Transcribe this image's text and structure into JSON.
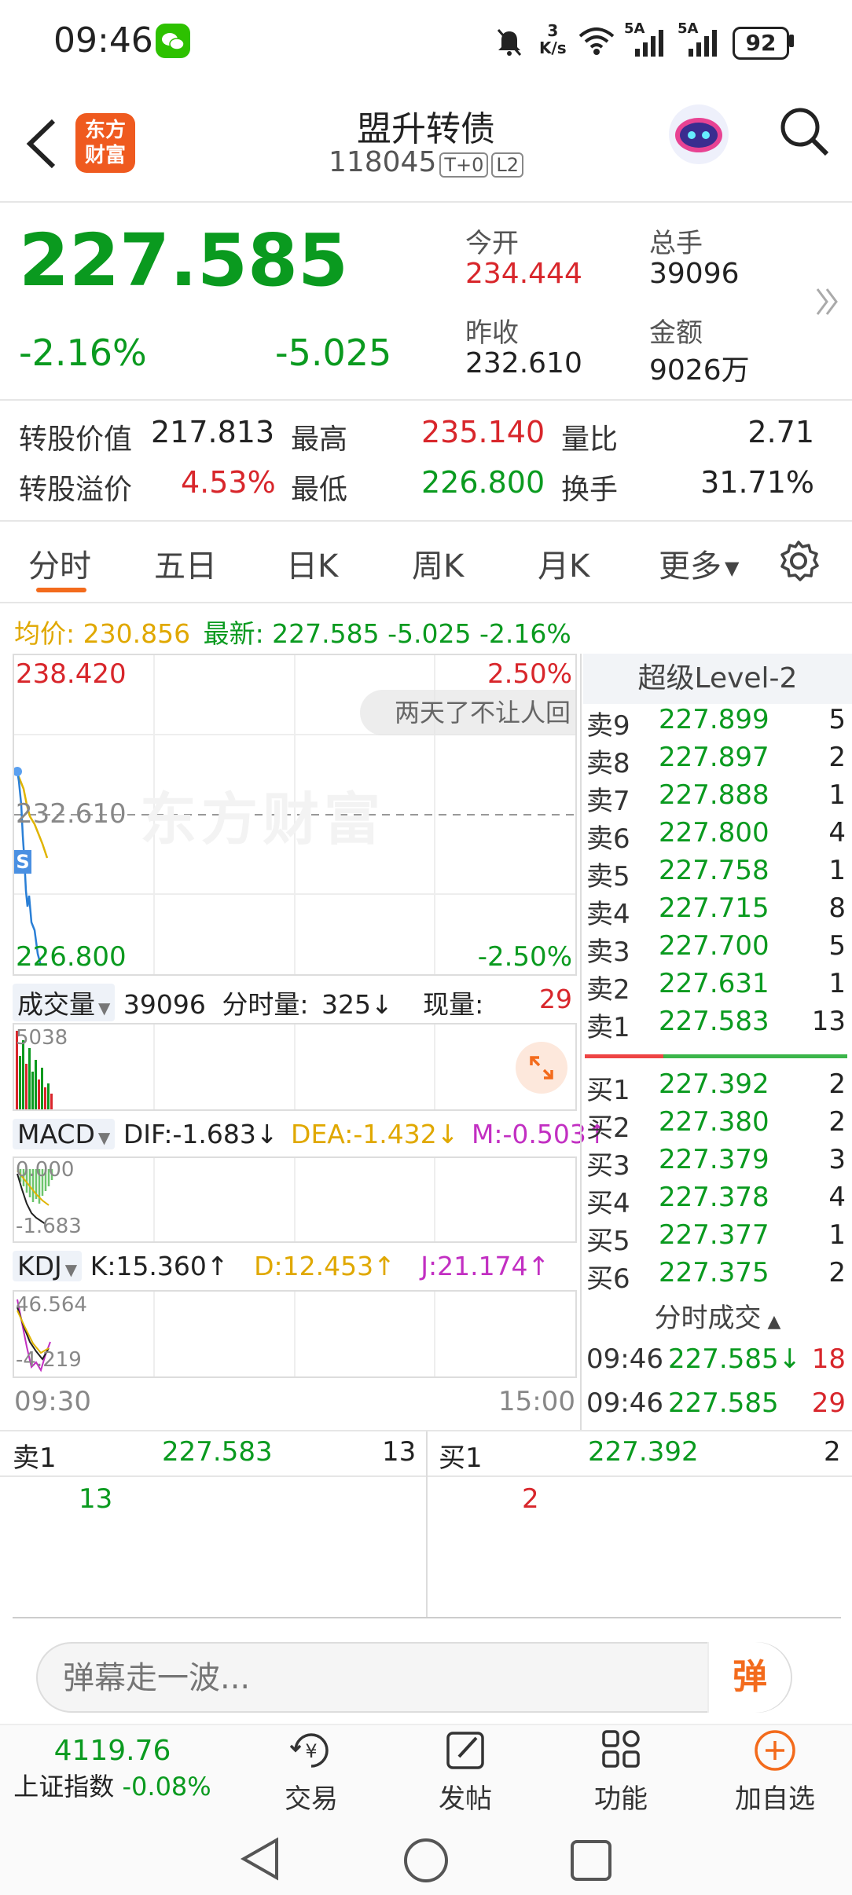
{
  "status": {
    "time": "09:46",
    "net_speed_top": "3",
    "net_speed_unit": "K/s",
    "signal1": "5A",
    "signal2": "5A",
    "battery": "92"
  },
  "header": {
    "logo_line1": "东方",
    "logo_line2": "财富",
    "title": "盟升转债",
    "code": "118045",
    "badge1": "T+0",
    "badge2": "L2"
  },
  "quote": {
    "price": "227.585",
    "change_pct": "-2.16%",
    "change": "-5.025",
    "open_label": "今开",
    "open": "234.444",
    "volume_label": "总手",
    "volume": "39096",
    "prev_close_label": "昨收",
    "prev_close": "232.610",
    "amount_label": "金额",
    "amount": "9026万"
  },
  "stats": {
    "conv_value_label": "转股价值",
    "conv_value": "217.813",
    "high_label": "最高",
    "high": "235.140",
    "vol_ratio_label": "量比",
    "vol_ratio": "2.71",
    "premium_label": "转股溢价",
    "premium": "4.53%",
    "low_label": "最低",
    "low": "226.800",
    "turnover_label": "换手",
    "turnover": "31.71%"
  },
  "tabs": [
    {
      "label": "分时"
    },
    {
      "label": "五日"
    },
    {
      "label": "日K"
    },
    {
      "label": "周K"
    },
    {
      "label": "月K"
    },
    {
      "label": "更多"
    }
  ],
  "chart_info": {
    "avg_label": "均价: 230.856",
    "latest_label": "最新: 227.585 -5.025 -2.16%",
    "top_price": "238.420",
    "top_pct": "2.50%",
    "mid_price": "232.610",
    "bottom_price": "226.800",
    "bottom_pct": "-2.50%",
    "watermark": "东方财富",
    "danmu": "两天了不让人回",
    "s_marker": "S",
    "time_start": "09:30",
    "time_end": "15:00"
  },
  "volume_panel": {
    "selector": "成交量",
    "total": "39096",
    "minute_label": "分时量:",
    "minute_value": "325↓",
    "current_label": "现量:",
    "current_value": "29",
    "axis_max": "5038"
  },
  "macd_panel": {
    "selector": "MACD",
    "dif": "DIF:-1.683↓",
    "dea": "DEA:-1.432↓",
    "m": "M:-0.503↑",
    "axis_top": "0.000",
    "axis_bottom": "-1.683"
  },
  "kdj_panel": {
    "selector": "KDJ",
    "k": "K:15.360↑",
    "d": "D:12.453↑",
    "j": "J:21.174↑",
    "axis_top": "46.564",
    "axis_bottom": "-4.219"
  },
  "order_book": {
    "title": "超级Level-2",
    "asks": [
      {
        "label": "卖9",
        "price": "227.899",
        "vol": "5"
      },
      {
        "label": "卖8",
        "price": "227.897",
        "vol": "2"
      },
      {
        "label": "卖7",
        "price": "227.888",
        "vol": "1"
      },
      {
        "label": "卖6",
        "price": "227.800",
        "vol": "4"
      },
      {
        "label": "卖5",
        "price": "227.758",
        "vol": "1"
      },
      {
        "label": "卖4",
        "price": "227.715",
        "vol": "8"
      },
      {
        "label": "卖3",
        "price": "227.700",
        "vol": "5"
      },
      {
        "label": "卖2",
        "price": "227.631",
        "vol": "1"
      },
      {
        "label": "卖1",
        "price": "227.583",
        "vol": "13"
      }
    ],
    "bids": [
      {
        "label": "买1",
        "price": "227.392",
        "vol": "2"
      },
      {
        "label": "买2",
        "price": "227.380",
        "vol": "2"
      },
      {
        "label": "买3",
        "price": "227.379",
        "vol": "3"
      },
      {
        "label": "买4",
        "price": "227.378",
        "vol": "4"
      },
      {
        "label": "买5",
        "price": "227.377",
        "vol": "1"
      },
      {
        "label": "买6",
        "price": "227.375",
        "vol": "2"
      }
    ],
    "trades_title": "分时成交",
    "trades": [
      {
        "time": "09:46",
        "price": "227.585↓",
        "vol": "18"
      },
      {
        "time": "09:46",
        "price": "227.585",
        "vol": "29"
      }
    ]
  },
  "queue": {
    "ask_label": "卖1",
    "ask_price": "227.583",
    "ask_vol": "13",
    "bid_label": "买1",
    "bid_price": "227.392",
    "bid_vol": "2",
    "ask_detail": "13",
    "bid_detail": "2"
  },
  "danmu_input": {
    "placeholder": "弹幕走一波...",
    "button": "弹"
  },
  "bottom_nav": {
    "index_value": "4119.76",
    "index_name": "上证指数",
    "index_change": "-0.08%",
    "trade": "交易",
    "post": "发帖",
    "functions": "功能",
    "add_watch": "加自选"
  },
  "colors": {
    "up": "#d8262b",
    "down": "#0a9a1f",
    "accent": "#f36b1c"
  }
}
